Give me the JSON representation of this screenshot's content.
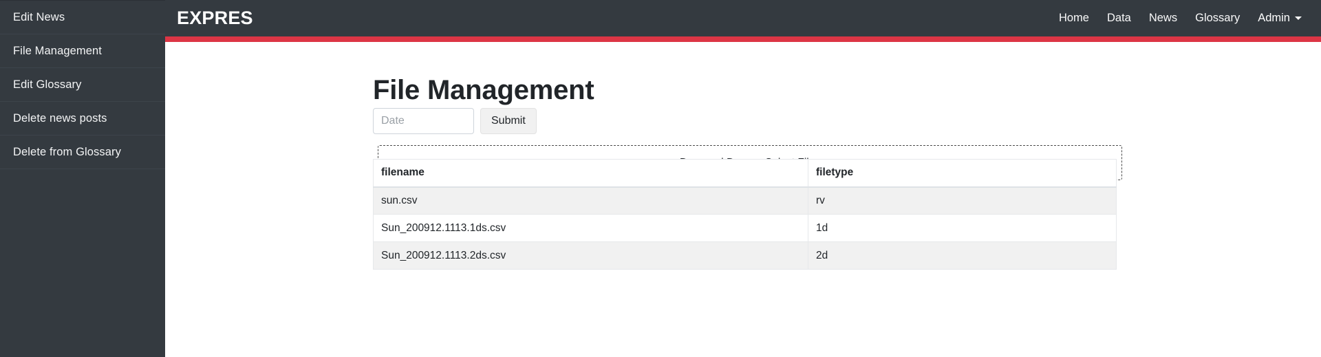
{
  "sidebar": {
    "items": [
      {
        "label": "Edit News",
        "name": "sidebar-item-edit-news"
      },
      {
        "label": "File Management",
        "name": "sidebar-item-file-management"
      },
      {
        "label": "Edit Glossary",
        "name": "sidebar-item-edit-glossary"
      },
      {
        "label": "Delete news posts",
        "name": "sidebar-item-delete-news-posts"
      },
      {
        "label": "Delete from Glossary",
        "name": "sidebar-item-delete-from-glossary"
      }
    ]
  },
  "navbar": {
    "brand": "EXPRES",
    "links": [
      {
        "label": "Home",
        "name": "nav-link-home"
      },
      {
        "label": "Data",
        "name": "nav-link-data"
      },
      {
        "label": "News",
        "name": "nav-link-news"
      },
      {
        "label": "Glossary",
        "name": "nav-link-glossary"
      }
    ],
    "dropdown": {
      "label": "Admin",
      "icon": "chevron-down-icon"
    }
  },
  "colors": {
    "navbar_bg": "#343a40",
    "accent_bar": "#dc3545",
    "sidebar_bg": "#343a40",
    "row_alt": "#f1f1f1"
  },
  "main": {
    "title": "File Management",
    "date_form": {
      "input_placeholder": "Date",
      "input_value": "",
      "submit_label": "Submit"
    },
    "dropzone": {
      "label": "Drag and Drop or Select Files"
    },
    "table": {
      "columns": [
        "filename",
        "filetype"
      ],
      "rows": [
        {
          "filename": "sun.csv",
          "filetype": "rv"
        },
        {
          "filename": "Sun_200912.1113.1ds.csv",
          "filetype": "1d"
        },
        {
          "filename": "Sun_200912.1113.2ds.csv",
          "filetype": "2d"
        }
      ]
    }
  }
}
